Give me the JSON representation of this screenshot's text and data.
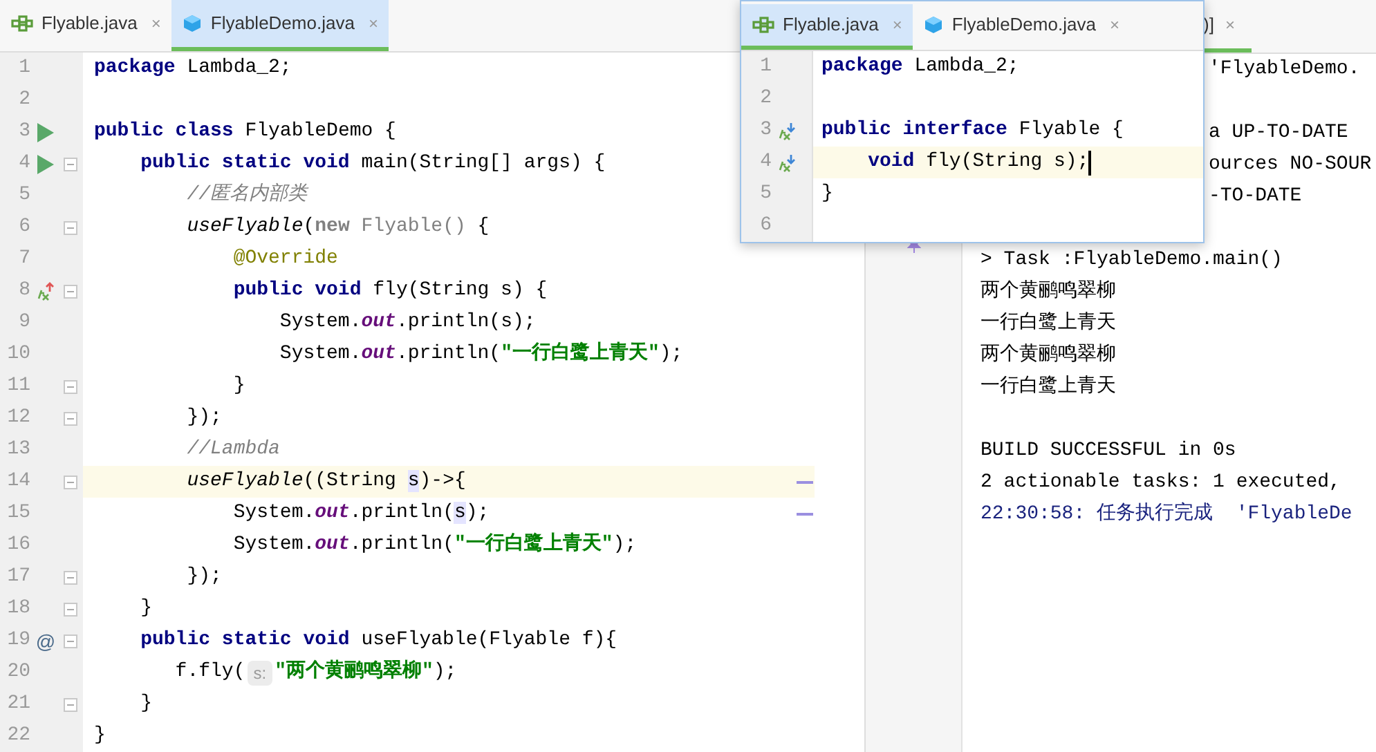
{
  "editor": {
    "tabs": [
      {
        "label": "Flyable.java",
        "kind": "interface",
        "close": "×",
        "selected": false
      },
      {
        "label": "FlyableDemo.java",
        "kind": "class",
        "close": "×",
        "selected": true
      }
    ],
    "lines": [
      {
        "number": "1",
        "tokens": [
          {
            "t": "package",
            "kind": "kw"
          },
          {
            "t": " Lambda_2;",
            "kind": "plain"
          }
        ]
      },
      {
        "number": "2"
      },
      {
        "number": "3",
        "marker": {
          "kind": "run"
        },
        "tokens": [
          {
            "t": "public class",
            "kind": "kw"
          },
          {
            "t": " FlyableDemo {",
            "kind": "plain"
          }
        ]
      },
      {
        "number": "4",
        "marker": {
          "kind": "run"
        },
        "fold": true,
        "tokens": [
          {
            "t": "    public static void",
            "kind": "kw"
          },
          {
            "t": " main(String[] args) {",
            "kind": "plain"
          }
        ]
      },
      {
        "number": "5",
        "tokens": [
          {
            "t": "        //匿名内部类",
            "kind": "comment"
          }
        ]
      },
      {
        "number": "6",
        "fold": true,
        "tokens": [
          {
            "t": "        useFlyable",
            "kind": "call"
          },
          {
            "t": "(",
            "kind": "plain"
          },
          {
            "t": "new",
            "kind": "dimkw"
          },
          {
            "t": " Flyable()",
            "kind": "dim"
          },
          {
            "t": " {",
            "kind": "plain"
          }
        ]
      },
      {
        "number": "7",
        "tokens": [
          {
            "t": "            @Override",
            "kind": "ann"
          }
        ]
      },
      {
        "number": "8",
        "marker": {
          "kind": "overriding"
        },
        "fold": true,
        "tokens": [
          {
            "t": "            public void",
            "kind": "kw"
          },
          {
            "t": " fly(String s) {",
            "kind": "plain"
          }
        ]
      },
      {
        "number": "9",
        "tokens": [
          {
            "t": "                System.",
            "kind": "plain"
          },
          {
            "t": "out",
            "kind": "field"
          },
          {
            "t": ".println(s);",
            "kind": "plain"
          }
        ]
      },
      {
        "number": "10",
        "tokens": [
          {
            "t": "                System.",
            "kind": "plain"
          },
          {
            "t": "out",
            "kind": "field"
          },
          {
            "t": ".println(",
            "kind": "plain"
          },
          {
            "t": "\"一行白鹭上青天\"",
            "kind": "str"
          },
          {
            "t": ");",
            "kind": "plain"
          }
        ]
      },
      {
        "number": "11",
        "fold": true,
        "tokens": [
          {
            "t": "            }",
            "kind": "plain"
          }
        ]
      },
      {
        "number": "12",
        "fold": true,
        "tokens": [
          {
            "t": "        });",
            "kind": "plain"
          }
        ]
      },
      {
        "number": "13",
        "tokens": [
          {
            "t": "        //Lambda",
            "kind": "comment"
          }
        ]
      },
      {
        "number": "14",
        "fold": true,
        "current": true,
        "stripe": true,
        "tokens": [
          {
            "t": "        useFlyable",
            "kind": "call"
          },
          {
            "t": "((String ",
            "kind": "plain"
          },
          {
            "t": "s",
            "kind": "usage"
          },
          {
            "t": ")->{",
            "kind": "plain"
          }
        ]
      },
      {
        "number": "15",
        "stripe": true,
        "tokens": [
          {
            "t": "            System.",
            "kind": "plain"
          },
          {
            "t": "out",
            "kind": "field"
          },
          {
            "t": ".println(",
            "kind": "plain"
          },
          {
            "t": "s",
            "kind": "usage"
          },
          {
            "t": ");",
            "kind": "plain"
          }
        ]
      },
      {
        "number": "16",
        "tokens": [
          {
            "t": "            System.",
            "kind": "plain"
          },
          {
            "t": "out",
            "kind": "field"
          },
          {
            "t": ".println(",
            "kind": "plain"
          },
          {
            "t": "\"一行白鹭上青天\"",
            "kind": "str"
          },
          {
            "t": ");",
            "kind": "plain"
          }
        ]
      },
      {
        "number": "17",
        "fold": true,
        "tokens": [
          {
            "t": "        });",
            "kind": "plain"
          }
        ]
      },
      {
        "number": "18",
        "fold": true,
        "tokens": [
          {
            "t": "    }",
            "kind": "plain"
          }
        ]
      },
      {
        "number": "19",
        "marker": {
          "kind": "usage",
          "text": "@"
        },
        "fold": true,
        "tokens": [
          {
            "t": "    public static void",
            "kind": "kw"
          },
          {
            "t": " useFlyable(Flyable f){",
            "kind": "plain"
          }
        ]
      },
      {
        "number": "20",
        "tokens": [
          {
            "t": "       f.fly(",
            "kind": "plain"
          },
          {
            "t": "s:",
            "kind": "hint"
          },
          {
            "t": "\"两个黄鹂鸣翠柳\"",
            "kind": "str"
          },
          {
            "t": ");",
            "kind": "plain"
          }
        ]
      },
      {
        "number": "21",
        "fold": true,
        "tokens": [
          {
            "t": "    }",
            "kind": "plain"
          }
        ]
      },
      {
        "number": "22",
        "tokens": [
          {
            "t": "}",
            "kind": "plain"
          }
        ]
      }
    ]
  },
  "run_panel": {
    "tab_label": ")]",
    "tab_close": "×",
    "lines": [
      {
        "kind": "tail",
        "text": "'FlyableDemo."
      },
      {
        "kind": "blank"
      },
      {
        "kind": "tail",
        "text": "a UP-TO-DATE"
      },
      {
        "kind": "tail",
        "text": "ources NO-SOUR"
      },
      {
        "kind": "tail",
        "text": "-TO-DATE"
      },
      {
        "kind": "blank"
      },
      {
        "kind": "output",
        "text": "> Task :FlyableDemo.main()"
      },
      {
        "kind": "output",
        "text": "两个黄鹂鸣翠柳"
      },
      {
        "kind": "output",
        "text": "一行白鹭上青天"
      },
      {
        "kind": "output",
        "text": "两个黄鹂鸣翠柳"
      },
      {
        "kind": "output",
        "text": "一行白鹭上青天"
      },
      {
        "kind": "blank"
      },
      {
        "kind": "output",
        "text": "BUILD SUCCESSFUL in 0s"
      },
      {
        "kind": "output",
        "text": "2 actionable tasks: 1 executed,"
      },
      {
        "kind": "info",
        "text": "22:30:58: 任务执行完成  'FlyableDe"
      }
    ]
  },
  "popup": {
    "tabs": [
      {
        "label": "Flyable.java",
        "kind": "interface",
        "close": "×",
        "selected": true
      },
      {
        "label": "FlyableDemo.java",
        "kind": "class",
        "close": "×",
        "selected": false
      }
    ],
    "lines": [
      {
        "number": "1",
        "tokens": [
          {
            "t": "package",
            "kind": "kw"
          },
          {
            "t": " Lambda_2;",
            "kind": "plain"
          }
        ]
      },
      {
        "number": "2"
      },
      {
        "number": "3",
        "marker": {
          "kind": "implemented"
        },
        "tokens": [
          {
            "t": "public interface",
            "kind": "kw"
          },
          {
            "t": " Flyable {",
            "kind": "plain"
          }
        ]
      },
      {
        "number": "4",
        "marker": {
          "kind": "implemented"
        },
        "current": true,
        "caret": true,
        "tokens": [
          {
            "t": "    void",
            "kind": "kw"
          },
          {
            "t": " fly(String s);",
            "kind": "plain"
          }
        ]
      },
      {
        "number": "5",
        "tokens": [
          {
            "t": "}",
            "kind": "plain"
          }
        ]
      },
      {
        "number": "6"
      }
    ]
  }
}
